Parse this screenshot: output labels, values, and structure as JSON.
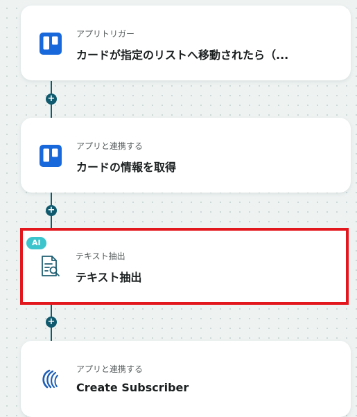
{
  "flow": {
    "steps": [
      {
        "kind": "trigger",
        "subtitle": "アプリトリガー",
        "title": "カードが指定のリストへ移動されたら（...",
        "icon": "trello-icon"
      },
      {
        "kind": "action",
        "subtitle": "アプリと連携する",
        "title": "カードの情報を取得",
        "icon": "trello-icon"
      },
      {
        "kind": "ai",
        "badge": "AI",
        "subtitle": "テキスト抽出",
        "title": "テキスト抽出",
        "icon": "document-search-icon",
        "selected": true
      },
      {
        "kind": "action",
        "subtitle": "アプリと連携する",
        "title": "Create Subscriber",
        "icon": "ripple-logo-icon"
      }
    ],
    "add_step_symbol": "+"
  },
  "colors": {
    "trello_blue": "#1868db",
    "connector": "#0f5a6e",
    "highlight_border": "#e2171d",
    "ai_badge": "#3cc4cc"
  }
}
